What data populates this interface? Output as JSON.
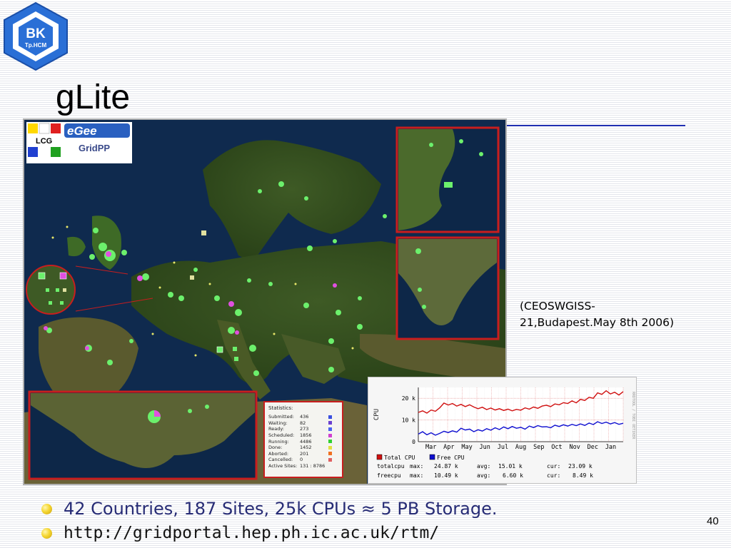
{
  "logo": {
    "line1": "BK",
    "line2": "Tp.HCM"
  },
  "slide": {
    "title": "gLite",
    "page_number": "40"
  },
  "caption": {
    "line1": "(CEOSWGISS-",
    "line2": "21,Budapest.May 8th 2006)"
  },
  "bullets": [
    {
      "text": "42 Countries, 187 Sites, 25k CPUs ≈ 5 PB Storage."
    },
    {
      "text": "http://gridportal.hep.ph.ic.ac.uk/rtm/"
    }
  ],
  "map_logos": {
    "lcg": "LCG",
    "egee": "eGee",
    "gridpp": "GridPP"
  },
  "statistics": {
    "title": "Statistics:",
    "rows": [
      {
        "label": "Submitted:",
        "value": "436",
        "color": "#3a50e0"
      },
      {
        "label": "Waiting:",
        "value": "82",
        "color": "#6a40d0"
      },
      {
        "label": "Ready:",
        "value": "273",
        "color": "#4a60f0"
      },
      {
        "label": "Scheduled:",
        "value": "1856",
        "color": "#d040d0"
      },
      {
        "label": "Running:",
        "value": "4486",
        "color": "#30d030"
      },
      {
        "label": "Done:",
        "value": "1452",
        "color": "#e0e040"
      },
      {
        "label": "Aborted:",
        "value": "201",
        "color": "#f07020"
      },
      {
        "label": "Cancelled:",
        "value": "0",
        "color": "#e06060"
      },
      {
        "label": "Active Sites:",
        "value": "131 : 8786",
        "color": ""
      }
    ]
  },
  "chart_data": {
    "type": "line",
    "categories": [
      "Mar",
      "Apr",
      "May",
      "Jun",
      "Jul",
      "Aug",
      "Sep",
      "Oct",
      "Nov",
      "Dec",
      "Jan"
    ],
    "ylabel": "CPU",
    "ylim": [
      0,
      25
    ],
    "yticks": [
      "20 k",
      "10 k",
      "0"
    ],
    "grid": true,
    "series": [
      {
        "name": "Total CPU",
        "color": "#d01010",
        "values": [
          13.5,
          14.2,
          13.2,
          14.6,
          14.0,
          15.6,
          17.8,
          16.9,
          17.6,
          16.4,
          17.2,
          16.2,
          17.0,
          16.0,
          15.2,
          15.9,
          14.8,
          15.5,
          14.6,
          15.2,
          14.4,
          15.0,
          14.2,
          14.9,
          14.5,
          15.6,
          15.0,
          16.0,
          15.4,
          16.4,
          16.8,
          16.2,
          17.4,
          17.0,
          18.0,
          17.6,
          18.8,
          17.9,
          19.5,
          19.0,
          20.5,
          20.0,
          22.5,
          21.8,
          23.5,
          22.0,
          22.8,
          21.5,
          23.09
        ]
      },
      {
        "name": "Free CPU",
        "color": "#1010d0",
        "values": [
          3.5,
          4.6,
          3.2,
          4.1,
          3.0,
          3.8,
          4.8,
          4.2,
          5.0,
          4.4,
          6.2,
          5.4,
          5.8,
          4.6,
          5.5,
          4.9,
          6.0,
          5.3,
          6.4,
          5.6,
          6.8,
          6.0,
          7.0,
          6.2,
          6.6,
          5.8,
          7.2,
          6.5,
          7.4,
          6.8,
          6.9,
          6.4,
          7.6,
          7.0,
          7.8,
          7.2,
          8.0,
          7.4,
          8.2,
          7.5,
          8.6,
          7.9,
          9.2,
          8.4,
          9.0,
          8.2,
          8.8,
          8.0,
          8.49
        ]
      }
    ],
    "legend": {
      "items": [
        "Total CPU",
        "Free CPU"
      ],
      "rows": [
        {
          "name": "totalcpu",
          "max_label": "max:",
          "max": "24.87 k",
          "avg_label": "avg:",
          "avg": "15.01 k",
          "cur_label": "cur:",
          "cur": "23.09 k"
        },
        {
          "name": "freecpu",
          "max_label": "max:",
          "max": "10.49 k",
          "avg_label": "avg:",
          "avg": "6.60 k",
          "cur_label": "cur:",
          "cur": "8.49 k"
        }
      ]
    },
    "watermark": "RRDTOOL / TOBI OETIKER"
  }
}
